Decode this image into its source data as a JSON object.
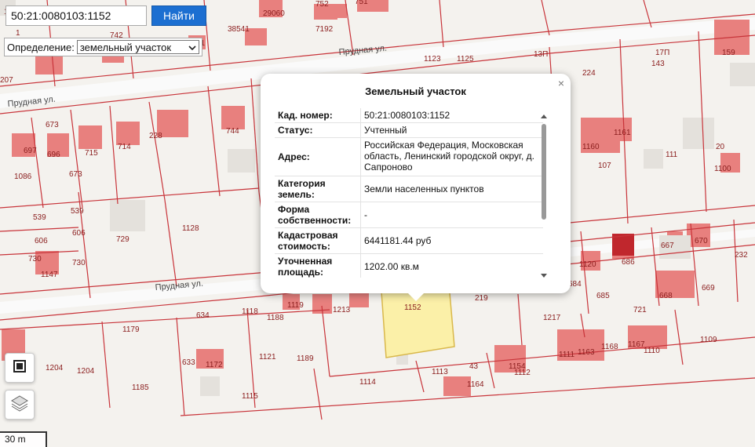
{
  "search": {
    "query": "50:21:0080103:1152",
    "button_label": "Найти"
  },
  "definition": {
    "label": "Определение:",
    "selected": "земельный участок"
  },
  "popup": {
    "title": "Земельный участок",
    "close_glyph": "×",
    "rows": [
      {
        "key": "Кад. номер:",
        "value": "50:21:0080103:1152"
      },
      {
        "key": "Статус:",
        "value": "Учтенный"
      },
      {
        "key": "Адрес:",
        "value": "Российская Федерация, Московская область, Ленинский городской округ, д. Сапроново"
      },
      {
        "key": "Категория земель:",
        "value": "Земли населенных пунктов"
      },
      {
        "key": "Форма собственности:",
        "value": "-"
      },
      {
        "key": "Кадастровая стоимость:",
        "value": "6441181.44 руб"
      },
      {
        "key": "Уточненная площадь:",
        "value": "1202.00 кв.м"
      }
    ]
  },
  "map": {
    "streets": [
      "Прудная ул.",
      "Прудная ул.",
      "Прудная ул."
    ],
    "parcel_labels": [
      "1",
      "29060",
      "752",
      "751",
      "1",
      "742",
      "38541",
      "7192",
      "61",
      "207",
      "1123",
      "1125",
      "13П",
      "17П",
      "143",
      "159",
      "224",
      "673",
      "673",
      "744",
      "697",
      "696",
      "715",
      "714",
      "228",
      "1086",
      "539",
      "539",
      "606",
      "606",
      "729",
      "1128",
      "730",
      "730",
      "1147",
      "1120",
      "1160",
      "1161",
      "107",
      "111",
      "20",
      "1100",
      "232",
      "667",
      "670",
      "684",
      "686",
      "685",
      "721",
      "668",
      "669",
      "1118",
      "1119",
      "1213",
      "1152",
      "219",
      "1179",
      "634",
      "1188",
      "1217",
      "1111",
      "1110",
      "1109",
      "1204",
      "1204",
      "1121",
      "1189",
      "1172",
      "633",
      "1185",
      "1113",
      "1154",
      "1112",
      "1114",
      "1164",
      "1115",
      "43",
      "1168",
      "1167",
      "1163"
    ],
    "layers_icon": "layers-icon",
    "frame_icon": "frame-icon"
  },
  "scale": {
    "label": "30 m"
  },
  "colors": {
    "building": "#e8807e",
    "building_selected": "#c0272d",
    "parcel_line": "#c8343a",
    "selected_fill": "#fbf0a8",
    "button": "#1c6fd1"
  }
}
